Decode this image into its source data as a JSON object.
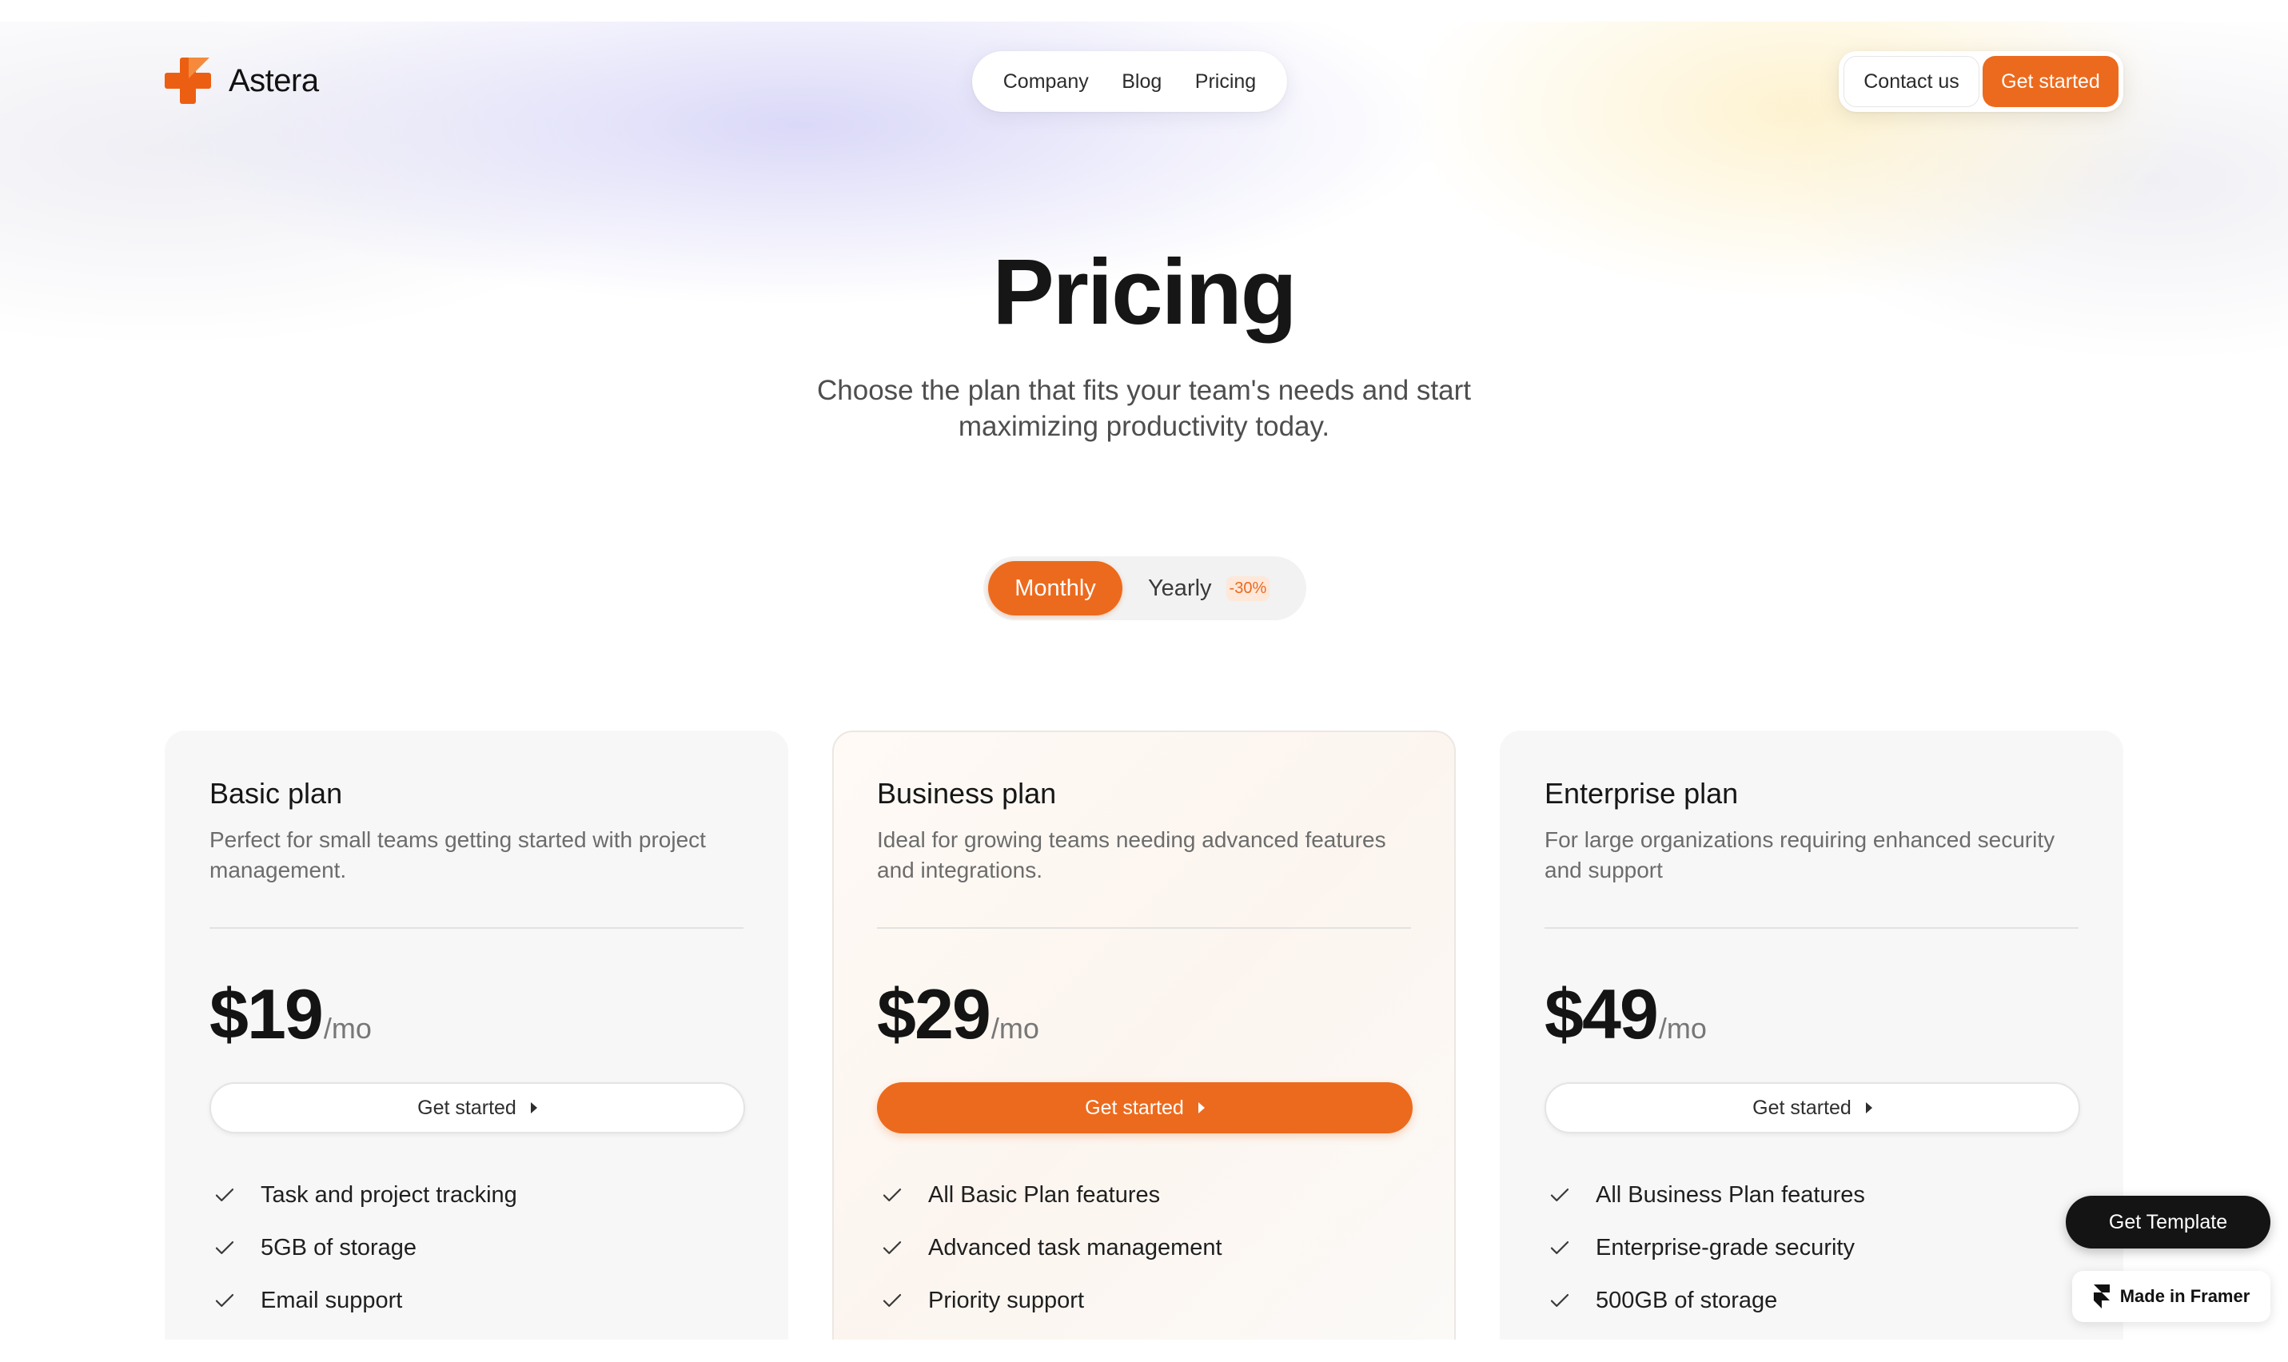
{
  "brand": {
    "name": "Astera",
    "accent": "#ec6a1d"
  },
  "nav": {
    "items": [
      {
        "label": "Company"
      },
      {
        "label": "Blog"
      },
      {
        "label": "Pricing"
      }
    ]
  },
  "header_actions": {
    "contact_label": "Contact us",
    "start_label": "Get started"
  },
  "hero": {
    "title": "Pricing",
    "subtitle": "Choose the plan that fits your team's needs and start maximizing productivity today."
  },
  "billing_toggle": {
    "monthly_label": "Monthly",
    "yearly_label": "Yearly",
    "yearly_badge": "-30%",
    "selected": "Monthly"
  },
  "plans": [
    {
      "name": "Basic plan",
      "description": "Perfect for small teams getting started with project management.",
      "price": "$19",
      "period": "/mo",
      "cta": "Get started",
      "features": [
        "Task and project tracking",
        "5GB of storage",
        "Email support"
      ]
    },
    {
      "name": "Business plan",
      "description": "Ideal for growing teams needing advanced features and integrations.",
      "price": "$29",
      "period": "/mo",
      "cta": "Get started",
      "features": [
        "All Basic Plan features",
        "Advanced task management",
        "Priority support"
      ]
    },
    {
      "name": "Enterprise plan",
      "description": "For large organizations requiring enhanced security and support",
      "price": "$49",
      "period": "/mo",
      "cta": "Get started",
      "features": [
        "All Business Plan features",
        "Enterprise-grade security",
        "500GB of storage"
      ]
    }
  ],
  "floating": {
    "template_label": "Get Template",
    "framer_label": "Made in Framer"
  }
}
